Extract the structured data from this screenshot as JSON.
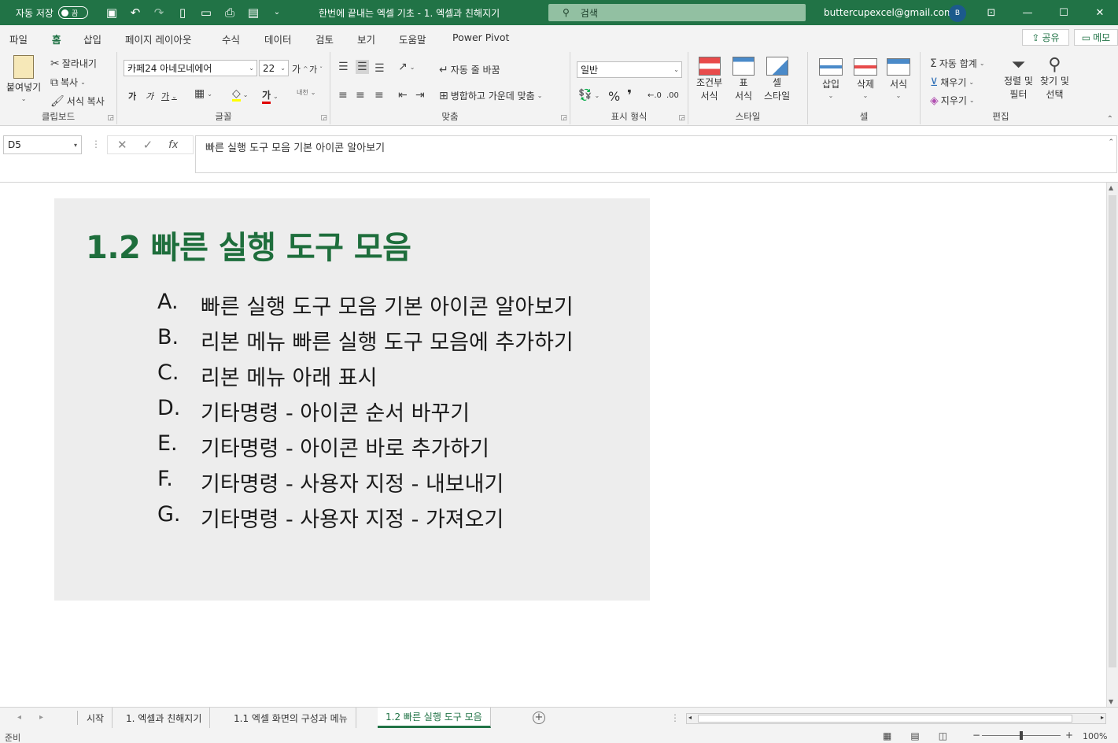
{
  "titlebar": {
    "autosave_label": "자동 저장",
    "autosave_state": "끔",
    "title": "한번에 끝내는 엑셀 기초 - 1. 엑셀과 친해지기",
    "search_placeholder": "검색",
    "user_email": "buttercupexcel@gmail.com",
    "avatar_initial": "B"
  },
  "menu": {
    "tabs": [
      "파일",
      "홈",
      "삽입",
      "페이지 레이아웃",
      "수식",
      "데이터",
      "검토",
      "보기",
      "도움말",
      "Power Pivot"
    ],
    "active_tab": "홈",
    "share_label": "공유",
    "memo_label": "메모"
  },
  "ribbon": {
    "clipboard": {
      "label": "클립보드",
      "paste": "붙여넣기",
      "cut": "잘라내기",
      "copy": "복사",
      "format_painter": "서식 복사"
    },
    "font": {
      "label": "글꼴",
      "font_name": "카페24 아네모네에어",
      "font_size": "22",
      "grow": "가",
      "shrink": "가",
      "bold": "가",
      "italic": "가",
      "underline": "가",
      "font_color": "가",
      "phonetic": "내천"
    },
    "alignment": {
      "label": "맞춤",
      "wrap_text": "자동 줄 바꿈",
      "merge_center": "병합하고 가운데 맞춤"
    },
    "number": {
      "label": "표시 형식",
      "format": "일반",
      "percent": "%",
      "comma": "❜",
      "inc_decimal": "←.0",
      "dec_decimal": ".00"
    },
    "styles": {
      "label": "스타일",
      "conditional_l1": "조건부",
      "conditional_l2": "서식",
      "table_l1": "표",
      "table_l2": "서식",
      "cell_l1": "셀",
      "cell_l2": "스타일"
    },
    "cells": {
      "label": "셀",
      "insert": "삽입",
      "delete": "삭제",
      "format": "서식"
    },
    "editing": {
      "label": "편집",
      "autosum": "자동 합계",
      "fill": "채우기",
      "clear": "지우기",
      "sort_l1": "정렬 및",
      "sort_l2": "필터",
      "find_l1": "찾기 및",
      "find_l2": "선택"
    }
  },
  "formula_bar": {
    "name_box": "D5",
    "content": "빠른 실행 도구 모음 기본 아이콘 알아보기"
  },
  "sheet": {
    "heading": "1.2 빠른 실행 도구 모음",
    "items": [
      {
        "marker": "A.",
        "text": "빠른 실행 도구 모음 기본 아이콘 알아보기"
      },
      {
        "marker": "B.",
        "text": "리본 메뉴 빠른 실행 도구 모음에 추가하기"
      },
      {
        "marker": "C.",
        "text": "리본 메뉴 아래 표시"
      },
      {
        "marker": "D.",
        "text": "기타명령 - 아이콘 순서 바꾸기"
      },
      {
        "marker": "E.",
        "text": "기타명령 - 아이콘 바로 추가하기"
      },
      {
        "marker": "F.",
        "text": "기타명령 - 사용자 지정 - 내보내기"
      },
      {
        "marker": "G.",
        "text": "기타명령 - 사용자 지정 - 가져오기"
      }
    ]
  },
  "sheet_tabs": {
    "tabs": [
      "시작",
      "1. 엑셀과 친해지기",
      "1.1 엑셀 화면의 구성과 메뉴",
      "1.2 빠른 실행 도구 모음"
    ],
    "active": "1.2 빠른 실행 도구 모음"
  },
  "status": {
    "ready": "준비",
    "zoom": "100%",
    "zoom_level": 0.5
  },
  "colors": {
    "accent": "#217346",
    "heading": "#1e6e3c",
    "card_bg": "#ededed"
  }
}
